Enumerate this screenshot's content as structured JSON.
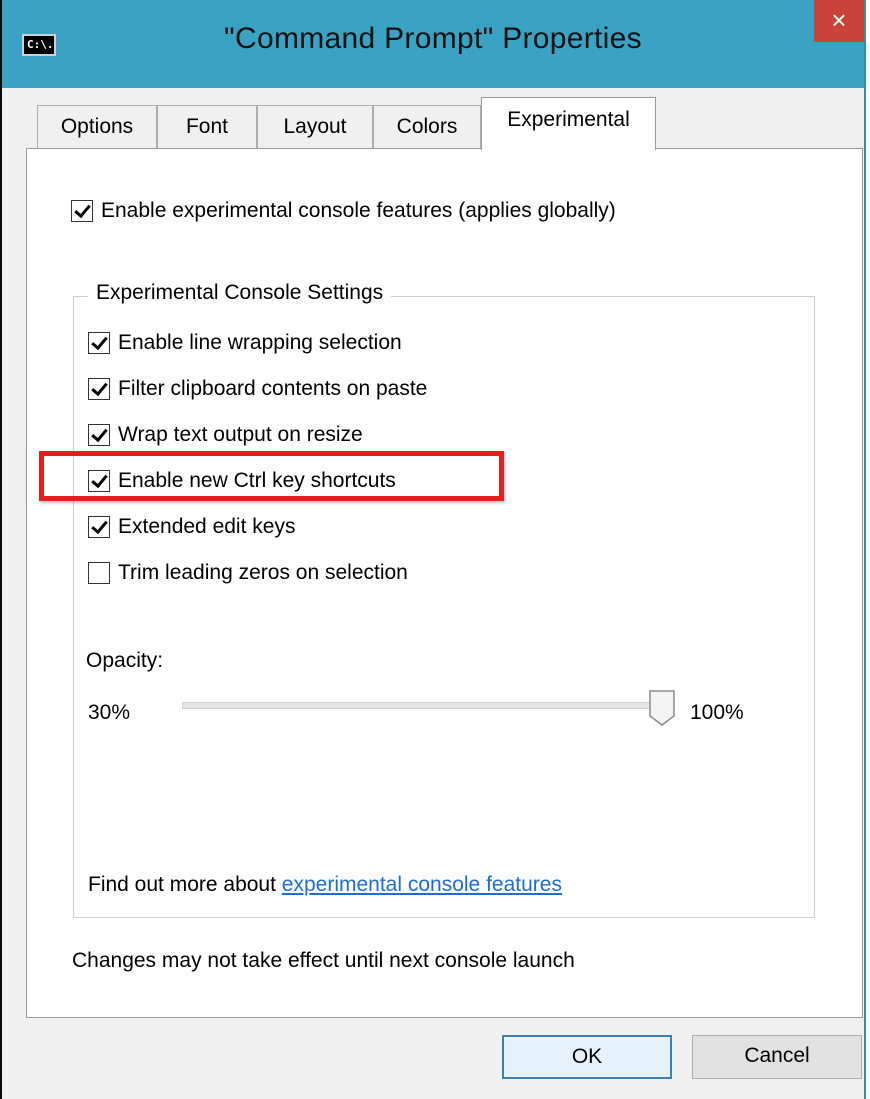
{
  "window": {
    "title": "\"Command Prompt\" Properties",
    "icon_text": "C:\\.",
    "close_glyph": "×"
  },
  "tabs": [
    {
      "label": "Options",
      "active": false
    },
    {
      "label": "Font",
      "active": false
    },
    {
      "label": "Layout",
      "active": false
    },
    {
      "label": "Colors",
      "active": false
    },
    {
      "label": "Experimental",
      "active": true
    }
  ],
  "experimental": {
    "enable_global": {
      "label": "Enable experimental console features (applies globally)",
      "checked": true
    },
    "group_title": "Experimental Console Settings",
    "options": [
      {
        "label": "Enable line wrapping selection",
        "checked": true
      },
      {
        "label": "Filter clipboard contents on paste",
        "checked": true
      },
      {
        "label": "Wrap text output on resize",
        "checked": true
      },
      {
        "label": "Enable new Ctrl key shortcuts",
        "checked": true,
        "highlighted": true
      },
      {
        "label": "Extended edit keys",
        "checked": true
      },
      {
        "label": "Trim leading zeros on selection",
        "checked": false
      }
    ],
    "opacity": {
      "label": "Opacity:",
      "min_label": "30%",
      "max_label": "100%",
      "value_percent": 100
    },
    "link_prefix": "Find out more about",
    "link_text": "experimental console features",
    "footnote": "Changes may not take effect until next console launch"
  },
  "buttons": {
    "ok": "OK",
    "cancel": "Cancel"
  },
  "colors": {
    "titlebar": "#3aa3c4",
    "close": "#c9433a",
    "highlight": "#e3201e",
    "link": "#1a6ed6"
  }
}
